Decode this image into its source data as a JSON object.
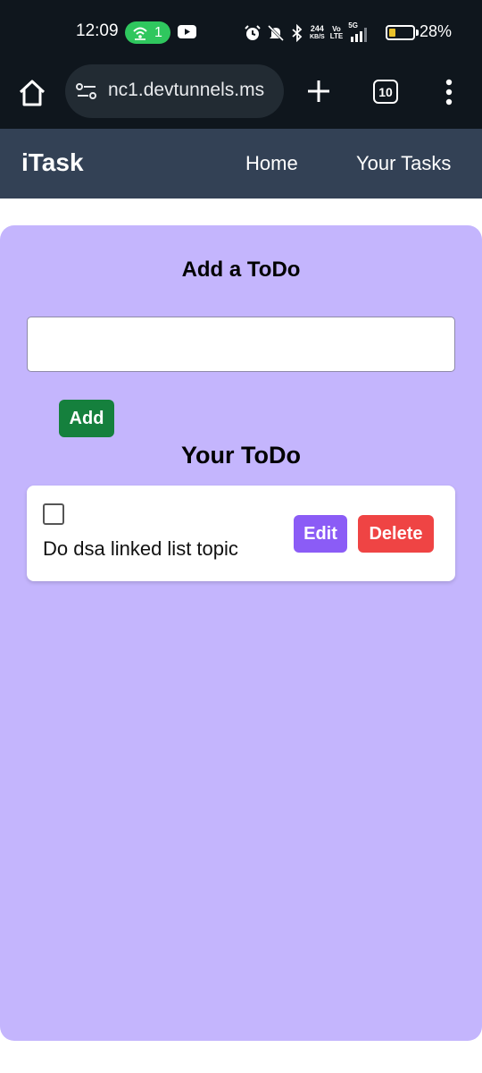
{
  "status_bar": {
    "time": "12:09",
    "hotspot_count": "1",
    "net_speed_value": "244",
    "net_speed_unit": "KB/S",
    "volte_line1": "Vo",
    "volte_line2": "LTE",
    "network_type": "5G",
    "battery_percent": "28%",
    "battery_level": 0.28,
    "icons": [
      "hotspot-icon",
      "youtube-icon",
      "alarm-icon",
      "mute-icon",
      "bluetooth-icon",
      "signal-icon",
      "battery-icon"
    ]
  },
  "browser": {
    "url": "nc1.devtunnels.ms",
    "tab_count": "10",
    "icons": [
      "home-icon",
      "site-settings-icon",
      "plus-icon",
      "more-vert-icon"
    ]
  },
  "navbar": {
    "brand": "iTask",
    "links": [
      "Home",
      "Your Tasks"
    ]
  },
  "main": {
    "add_heading": "Add a ToDo",
    "input_value": "",
    "add_button": "Add",
    "list_heading": "Your ToDo",
    "todos": [
      {
        "text": "Do dsa linked list topic",
        "completed": false,
        "edit_label": "Edit",
        "delete_label": "Delete"
      }
    ]
  },
  "colors": {
    "status_bg": "#0f161d",
    "navbar_bg": "#334155",
    "panel_bg": "#c4b5fd",
    "add_button": "#15803d",
    "edit_button": "#8b5cf6",
    "delete_button": "#ef4444",
    "hotspot_pill": "#2fc75e",
    "battery_fill": "#e8c02a"
  }
}
